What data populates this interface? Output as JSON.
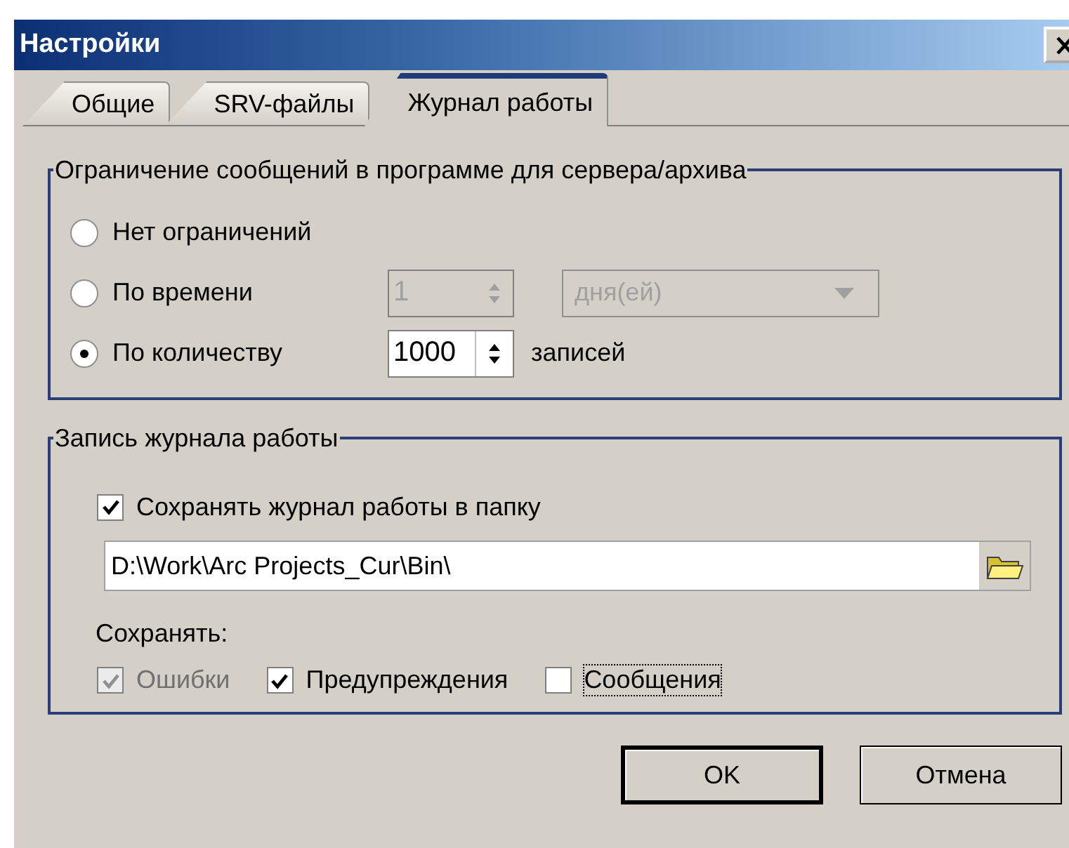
{
  "window": {
    "title": "Настройки"
  },
  "tabs": [
    {
      "label": "Общие",
      "selected": false
    },
    {
      "label": "SRV-файлы",
      "selected": false
    },
    {
      "label": "Журнал работы",
      "selected": true
    }
  ],
  "limit_group": {
    "legend": "Ограничение сообщений в программе для сервера/архива",
    "options": [
      {
        "kind": "plain",
        "label": "Нет ограничений",
        "selected": false
      },
      {
        "kind": "time",
        "label": "По времени",
        "selected": false,
        "spinner": {
          "value": "1",
          "disabled": true
        },
        "dropdown": {
          "value": "дня(ей)",
          "disabled": true
        }
      },
      {
        "kind": "count",
        "label": "По количеству",
        "selected": true,
        "spinner": {
          "value": "1000",
          "disabled": false
        },
        "unit": "записей"
      }
    ]
  },
  "log_group": {
    "legend": "Запись журнала работы",
    "save_to_folder": {
      "label": "Сохранять журнал работы в папку",
      "checked": true
    },
    "folder_path": "D:\\Work\\Arc Projects_Cur\\Bin\\",
    "save_label": "Сохранять:",
    "save_types": [
      {
        "label": "Ошибки",
        "checked": true,
        "disabled": true,
        "focused": false
      },
      {
        "label": "Предупреждения",
        "checked": true,
        "disabled": false,
        "focused": false
      },
      {
        "label": "Сообщения",
        "checked": false,
        "disabled": false,
        "focused": true
      }
    ]
  },
  "buttons": [
    {
      "label": "OK",
      "default": true
    },
    {
      "label": "Отмена",
      "default": false
    }
  ]
}
